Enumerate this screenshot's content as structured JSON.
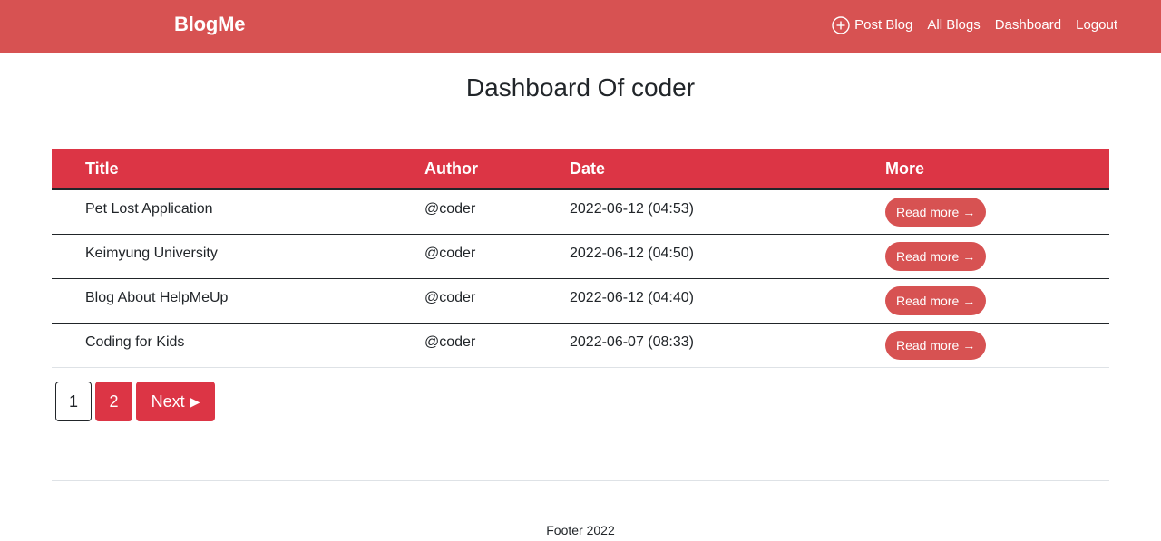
{
  "navbar": {
    "brand": "BlogMe",
    "links": [
      {
        "label": "Post Blog",
        "icon": "plus-circle-icon"
      },
      {
        "label": "All Blogs"
      },
      {
        "label": "Dashboard"
      },
      {
        "label": "Logout"
      }
    ],
    "background": "#d75252"
  },
  "page": {
    "title": "Dashboard Of coder"
  },
  "table": {
    "headers": [
      "Title",
      "Author",
      "Date",
      "More"
    ],
    "rows": [
      {
        "title": "Pet Lost Application",
        "author": "@coder",
        "date": "2022-06-12 (04:53)",
        "action": "Read more"
      },
      {
        "title": "Keimyung University",
        "author": "@coder",
        "date": "2022-06-12 (04:50)",
        "action": "Read more"
      },
      {
        "title": "Blog About HelpMeUp",
        "author": "@coder",
        "date": "2022-06-12 (04:40)",
        "action": "Read more"
      },
      {
        "title": "Coding for Kids",
        "author": "@coder",
        "date": "2022-06-07 (08:33)",
        "action": "Read more"
      }
    ],
    "header_color": "#dc3545"
  },
  "pagination": {
    "pages": [
      "1",
      "2"
    ],
    "current_page": "2",
    "next_label": "Next"
  },
  "footer": {
    "text": "Footer 2022"
  },
  "colors": {
    "accent": "#dc3545",
    "nav": "#d75252",
    "button": "#d75252"
  }
}
